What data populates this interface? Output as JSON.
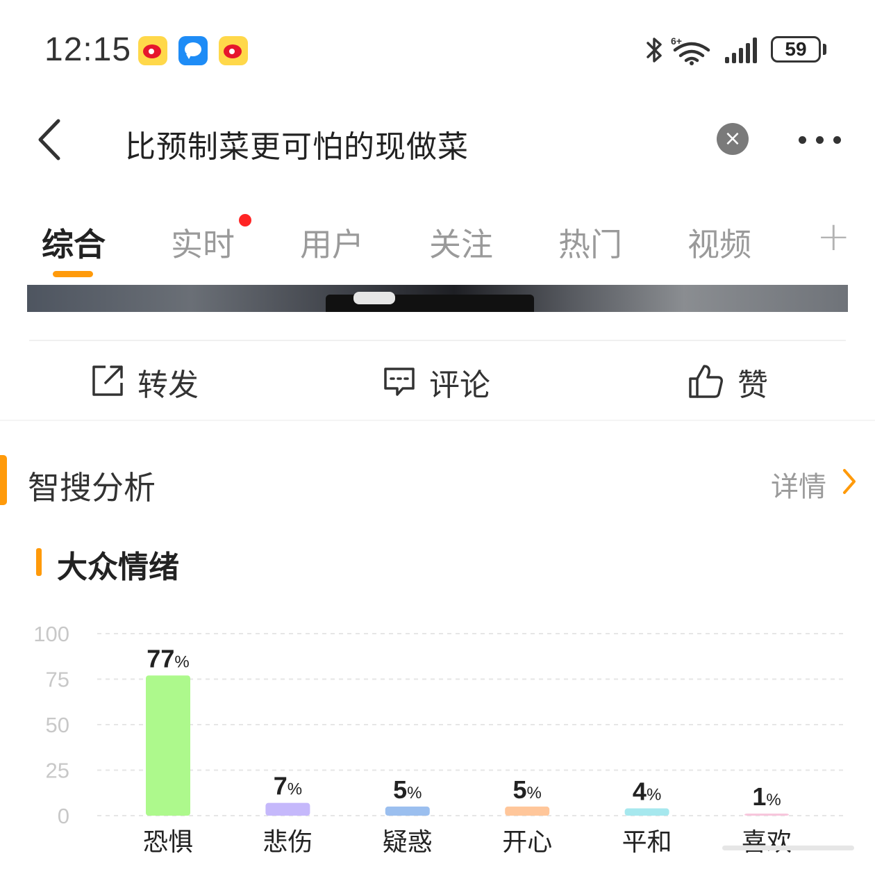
{
  "status_bar": {
    "time": "12:15",
    "notification_icons": [
      "weibo-icon",
      "message-icon",
      "weibo-icon"
    ],
    "battery": "59",
    "network_label": "6+"
  },
  "header": {
    "search_query": "比预制菜更可怕的现做菜",
    "clear_icon": "×"
  },
  "tabs": [
    {
      "label": "综合",
      "active": true
    },
    {
      "label": "实时",
      "badge": true
    },
    {
      "label": "用户"
    },
    {
      "label": "关注"
    },
    {
      "label": "热门"
    },
    {
      "label": "视频"
    },
    {
      "label": "+"
    }
  ],
  "post_actions": {
    "repost": "转发",
    "comment": "评论",
    "like": "赞"
  },
  "smart_search": {
    "title": "智搜分析",
    "details_link": "详情"
  },
  "emotion_section": {
    "title": "大众情绪"
  },
  "colors": {
    "accent": "#ff9a0a",
    "badge_red": "#ff2424"
  },
  "chart_data": {
    "type": "bar",
    "title": "大众情绪",
    "categories": [
      "恐惧",
      "悲伤",
      "疑惑",
      "开心",
      "平和",
      "喜欢"
    ],
    "values": [
      77,
      7,
      5,
      5,
      4,
      1
    ],
    "value_suffix": "%",
    "bar_colors": [
      "#adf98c",
      "#c5b8fb",
      "#9bbfef",
      "#ffc69a",
      "#a6e8ee",
      "#f8c6dc"
    ],
    "ylim": [
      0,
      100
    ],
    "yticks": [
      0,
      25,
      50,
      75,
      100
    ],
    "grid": true,
    "legend": "none"
  }
}
